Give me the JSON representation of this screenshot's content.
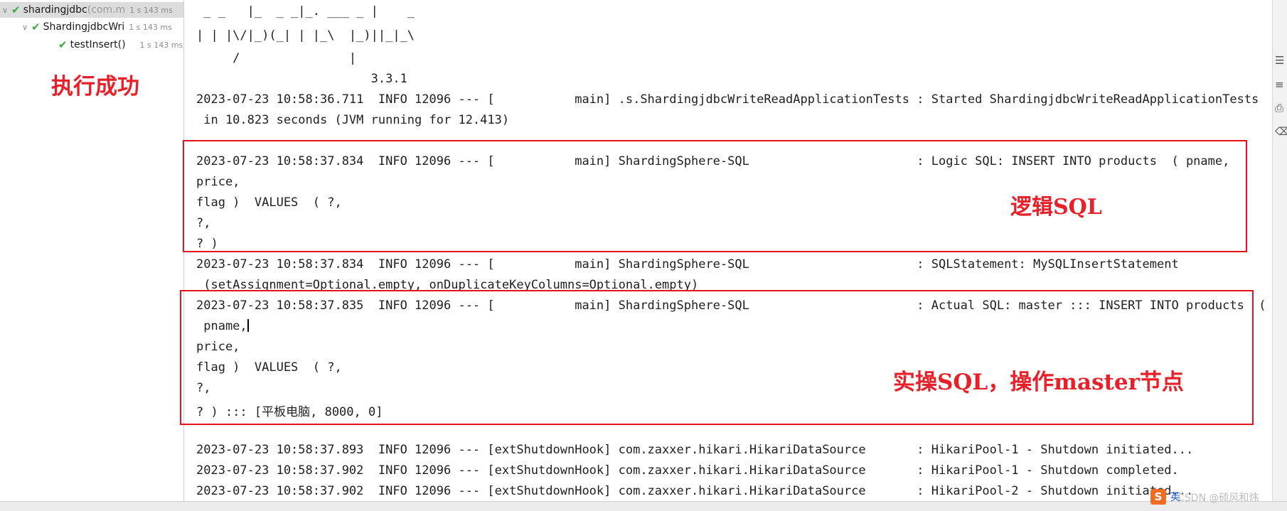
{
  "test_tree": [
    {
      "name": "shardingjdbc",
      "package": " (com.m",
      "duration": "1 s 143 ms",
      "expanded": true
    },
    {
      "name": "ShardingjdbcWri",
      "package": "",
      "duration": "1 s 143 ms",
      "expanded": true
    },
    {
      "name": "testInsert()",
      "package": "",
      "duration": "1 s 143 ms",
      "expanded": false
    }
  ],
  "annotations": {
    "success": "执行成功",
    "logic_sql": "逻辑SQL",
    "actual_sql": "实操SQL，操作master节点"
  },
  "console_lines": [
    " _ _   |_  _ _|_. ___ _ |    _",
    "| | |\\/|_)(_| | |_\\  |_)||_|_\\",
    "     /               |",
    "                        3.3.1",
    "2023-07-23 10:58:36.711  INFO 12096 --- [           main] .s.ShardingjdbcWriteReadApplicationTests : Started ShardingjdbcWriteReadApplicationTests",
    " in 10.823 seconds (JVM running for 12.413)",
    "2023-07-23 10:58:37.834  INFO 12096 --- [           main] ShardingSphere-SQL                       : Logic SQL: INSERT INTO products  ( pname,",
    "price,",
    "flag )  VALUES  ( ?,",
    "?,",
    "? )",
    "2023-07-23 10:58:37.834  INFO 12096 --- [           main] ShardingSphere-SQL                       : SQLStatement: MySQLInsertStatement",
    " (setAssignment=Optional.empty, onDuplicateKeyColumns=Optional.empty)",
    "2023-07-23 10:58:37.835  INFO 12096 --- [           main] ShardingSphere-SQL                       : Actual SQL: master ::: INSERT INTO products  (",
    " pname,",
    "price,",
    "flag )  VALUES  ( ?,",
    "?,",
    "? ) ::: [平板电脑, 8000, 0]",
    "2023-07-23 10:58:37.893  INFO 12096 --- [extShutdownHook] com.zaxxer.hikari.HikariDataSource       : HikariPool-1 - Shutdown initiated...",
    "2023-07-23 10:58:37.902  INFO 12096 --- [extShutdownHook] com.zaxxer.hikari.HikariDataSource       : HikariPool-1 - Shutdown completed.",
    "2023-07-23 10:58:37.902  INFO 12096 --- [extShutdownHook] com.zaxxer.hikari.HikariDataSource       : HikariPool-2 - Shutdown initiated..."
  ],
  "watermark": "CSDN @硕风和炜",
  "ime_label": "英",
  "ime_logo": "S"
}
